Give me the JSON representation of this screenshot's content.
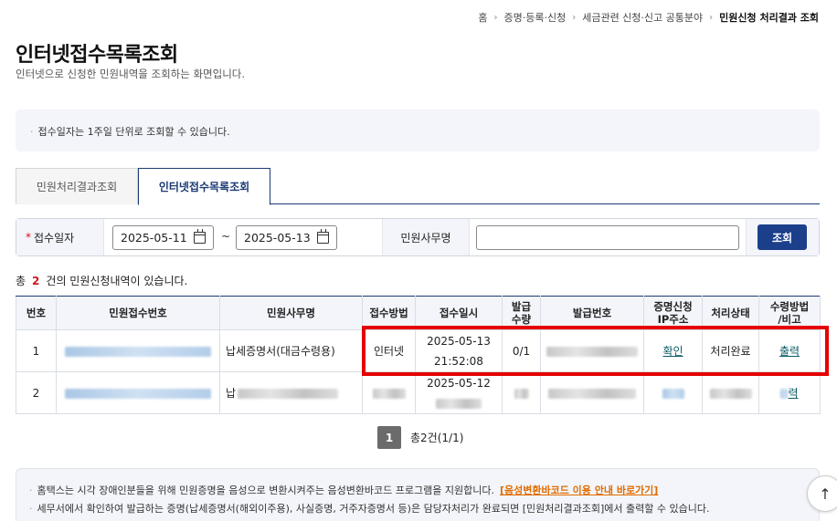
{
  "breadcrumb": [
    "홈",
    "증명·등록·신청",
    "세금관련 신청·신고 공통분야",
    "민원신청 처리결과 조회"
  ],
  "page": {
    "title": "인터넷접수목록조회",
    "description": "인터넷으로 신청한 민원내역을 조회하는 화면입니다."
  },
  "notice": "접수일자는 1주일 단위로 조회할 수 있습니다.",
  "tabs": [
    {
      "label": "민원처리결과조회"
    },
    {
      "label": "인터넷접수목록조회"
    }
  ],
  "search": {
    "date_label": "접수일자",
    "date_from": "2025-05-11",
    "date_to": "2025-05-13",
    "range_sep": "~",
    "office_label": "민원사무명",
    "office_value": "",
    "button_label": "조회"
  },
  "summary": {
    "prefix": "총",
    "count": "2",
    "suffix": "건의 민원신청내역이 있습니다."
  },
  "table": {
    "headers": [
      "번호",
      "민원접수번호",
      "민원사무명",
      "접수방법",
      "접수일시",
      "발급\n수량",
      "발급번호",
      "증명신청\nIP주소",
      "처리상태",
      "수령방법\n/비고"
    ],
    "rows": [
      {
        "no": "1",
        "office": "납세증명서(대금수령용)",
        "method": "인터넷",
        "date": "2025-05-13",
        "time": "21:52:08",
        "qty": "0/1",
        "ip": "확인",
        "status": "처리완료",
        "receive": "출력"
      },
      {
        "no": "2",
        "office": "납",
        "date": "2025-05-12",
        "receive": "력"
      }
    ]
  },
  "pager": {
    "current": "1",
    "summary": "총2건(1/1)"
  },
  "info": {
    "line1": "홈택스는 시각 장애인분들을 위해 민원증명을 음성으로 변환시켜주는 음성변환바코드 프로그램을 지원합니다.",
    "line1_link": "[음성변환바코드 이용 안내 바로가기]",
    "line2": "세무서에서 확인하여 발급하는 증명(납세증명서(해외이주용), 사실증명, 거주자증명서 등)은 담당자처리가 완료되면 [민원처리결과조회]에서 출력할 수 있습니다."
  },
  "icons": {
    "calendar": "calendar-icon",
    "scroll_top": "arrow-up-icon",
    "scroll_top_glyph": "↑"
  },
  "colors": {
    "primary": "#1b3f8b",
    "required": "#d6141c",
    "highlight": "#e50000",
    "link": "#0d5d66"
  }
}
